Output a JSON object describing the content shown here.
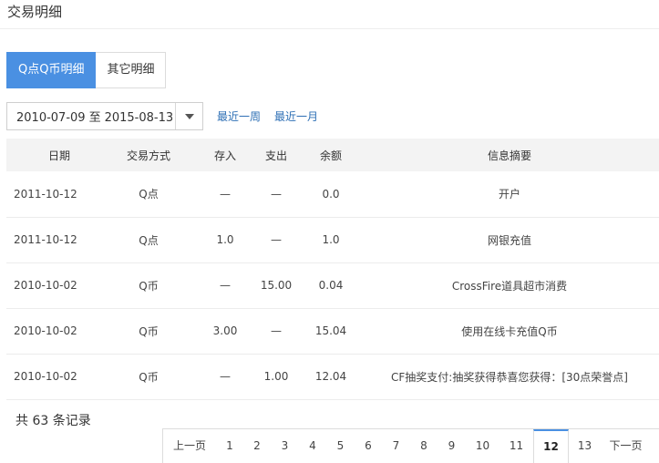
{
  "page": {
    "title": "交易明细"
  },
  "tabs": [
    {
      "label": "Q点Q币明细",
      "active": true
    },
    {
      "label": "其它明细",
      "active": false
    }
  ],
  "filter": {
    "date_from": "2010-07-09",
    "separator": "至",
    "date_to": "2015-08-13",
    "quick_week": "最近一周",
    "quick_month": "最近一月"
  },
  "table": {
    "headers": [
      "日期",
      "交易方式",
      "存入",
      "支出",
      "余额",
      "信息摘要"
    ],
    "rows": [
      [
        "2011-10-12",
        "Q点",
        "—",
        "—",
        "0.0",
        "开户"
      ],
      [
        "2011-10-12",
        "Q点",
        "1.0",
        "—",
        "1.0",
        "网银充值"
      ],
      [
        "2010-10-02",
        "Q币",
        "—",
        "15.00",
        "0.04",
        "CrossFire道具超市消费"
      ],
      [
        "2010-10-02",
        "Q币",
        "3.00",
        "—",
        "15.04",
        "使用在线卡充值Q币"
      ],
      [
        "2010-10-02",
        "Q币",
        "—",
        "1.00",
        "12.04",
        "CF抽奖支付:抽奖获得恭喜您获得：[30点荣誉点]"
      ]
    ]
  },
  "summary": {
    "prefix": "共",
    "count": "63",
    "suffix": "条记录"
  },
  "pagination": {
    "prev": "上一页",
    "next": "下一页",
    "pages": [
      "1",
      "2",
      "3",
      "4",
      "5",
      "6",
      "7",
      "8",
      "9",
      "10",
      "11",
      "12",
      "13"
    ],
    "current": "12"
  },
  "colors": {
    "accent": "#4a90e2",
    "link": "#2d6fb5",
    "header_bg": "#f3f3f3"
  },
  "icons": {
    "date_dropdown": "chevron-down-icon"
  }
}
